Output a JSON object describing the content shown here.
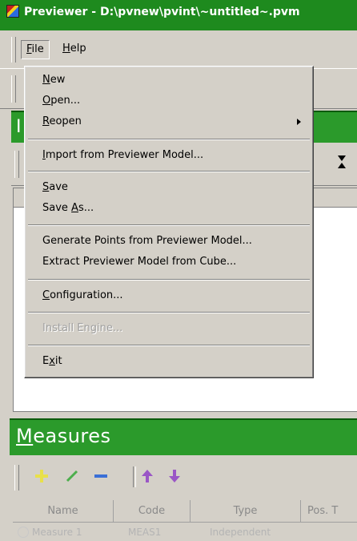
{
  "window": {
    "title": "Previewer - D:\\pvnew\\pvint\\~untitled~.pvm"
  },
  "menubar": {
    "file": {
      "prefix": "",
      "accel": "F",
      "rest": "ile"
    },
    "help": {
      "prefix": "",
      "accel": "H",
      "rest": "elp"
    }
  },
  "file_menu": {
    "new": {
      "accel": "N",
      "rest": "ew"
    },
    "open": {
      "accel": "O",
      "rest": "pen..."
    },
    "reopen": {
      "accel": "R",
      "rest": "eopen"
    },
    "import": {
      "accel": "I",
      "rest": "mport from Previewer Model..."
    },
    "save": {
      "accel": "S",
      "rest": "ave"
    },
    "save_as": {
      "prefix": "Save ",
      "accel": "A",
      "rest": "s..."
    },
    "generate": {
      "label": "Generate Points from Previewer Model..."
    },
    "extract": {
      "label": "Extract Previewer Model from Cube..."
    },
    "config": {
      "accel": "C",
      "rest": "onfiguration..."
    },
    "install": {
      "label": "Install Engine..."
    },
    "exit": {
      "prefix": "E",
      "accel": "x",
      "rest": "it"
    }
  },
  "green_band": {
    "letter": "I"
  },
  "measures": {
    "title_accel": "M",
    "title_rest": "easures",
    "columns": [
      "Name",
      "Code",
      "Type",
      "Pos. T"
    ],
    "rows": [
      {
        "name": "Measure 1",
        "code": "MEAS1",
        "type": "Independent"
      }
    ]
  },
  "icons": {
    "app": "app-icon",
    "submenu": "chevron-right-icon",
    "sort": "sort-arrows-icon",
    "add": "plus-icon",
    "edit": "pencil-icon",
    "remove": "minus-icon",
    "move_up": "arrow-up-icon",
    "move_down": "arrow-down-icon"
  },
  "colors": {
    "title_green": "#1e8a1e",
    "band_green": "#2b9a2b",
    "add": "#e8e04a",
    "edit": "#4cae4c",
    "remove": "#3a6fd6",
    "arrows": "#9a56c6"
  }
}
